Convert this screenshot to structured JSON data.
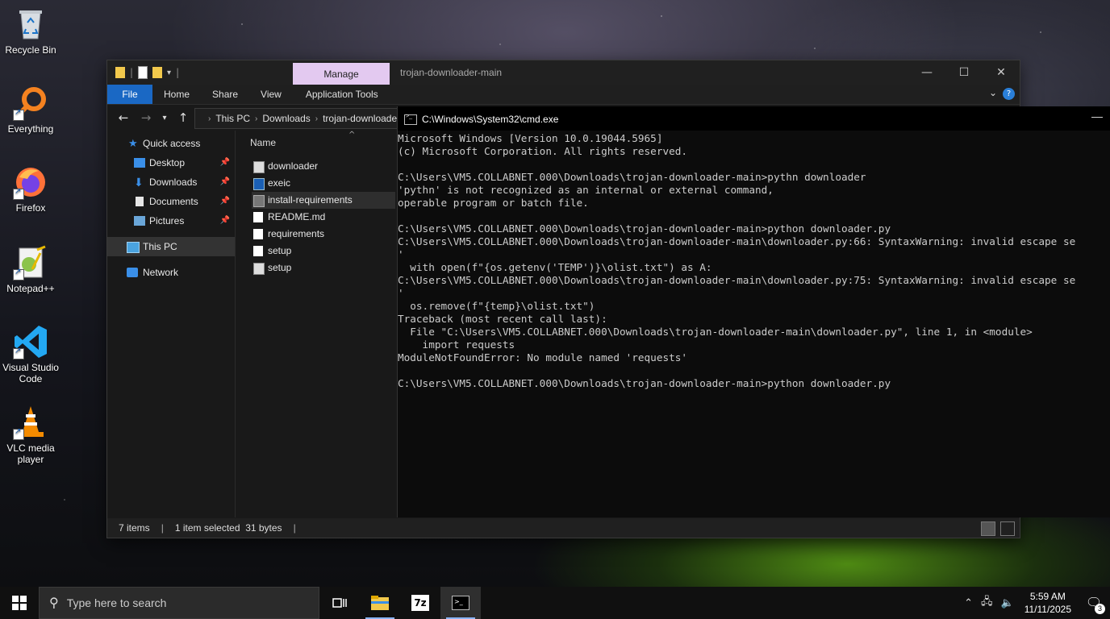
{
  "desktop": {
    "icons": [
      {
        "label": "Recycle Bin",
        "icon": "recycle-bin-icon"
      },
      {
        "label": "Everything",
        "icon": "everything-icon"
      },
      {
        "label": "Firefox",
        "icon": "firefox-icon"
      },
      {
        "label": "Notepad++",
        "icon": "notepad-plus-plus-icon"
      },
      {
        "label": "Visual Studio Code",
        "icon": "vscode-icon"
      },
      {
        "label": "VLC media player",
        "icon": "vlc-icon"
      }
    ]
  },
  "explorer": {
    "contextual_tab": "Manage",
    "title": "trojan-downloader-main",
    "ribbon_tabs": [
      "File",
      "Home",
      "Share",
      "View",
      "Application Tools"
    ],
    "breadcrumb": [
      "This PC",
      "Downloads",
      "trojan-downloader-main"
    ],
    "nav": {
      "quick_access": "Quick access",
      "pinned": [
        "Desktop",
        "Downloads",
        "Documents",
        "Pictures"
      ],
      "this_pc": "This PC",
      "network": "Network"
    },
    "column_header": "Name",
    "files": [
      {
        "name": "downloader",
        "type": "python"
      },
      {
        "name": "exeic",
        "type": "exe"
      },
      {
        "name": "install-requirements",
        "type": "batch",
        "selected": true
      },
      {
        "name": "README.md",
        "type": "text"
      },
      {
        "name": "requirements",
        "type": "text"
      },
      {
        "name": "setup",
        "type": "text"
      },
      {
        "name": "setup",
        "type": "python"
      }
    ],
    "status": {
      "items": "7 items",
      "selection": "1 item selected  31 bytes"
    }
  },
  "cmd": {
    "title": "C:\\Windows\\System32\\cmd.exe",
    "output": "Microsoft Windows [Version 10.0.19044.5965]\n(c) Microsoft Corporation. All rights reserved.\n\nC:\\Users\\VM5.COLLABNET.000\\Downloads\\trojan-downloader-main>pythn downloader\n'pythn' is not recognized as an internal or external command,\noperable program or batch file.\n\nC:\\Users\\VM5.COLLABNET.000\\Downloads\\trojan-downloader-main>python downloader.py\nC:\\Users\\VM5.COLLABNET.000\\Downloads\\trojan-downloader-main\\downloader.py:66: SyntaxWarning: invalid escape se\n'\n  with open(f\"{os.getenv('TEMP')}\\olist.txt\") as A:\nC:\\Users\\VM5.COLLABNET.000\\Downloads\\trojan-downloader-main\\downloader.py:75: SyntaxWarning: invalid escape se\n'\n  os.remove(f\"{temp}\\olist.txt\")\nTraceback (most recent call last):\n  File \"C:\\Users\\VM5.COLLABNET.000\\Downloads\\trojan-downloader-main\\downloader.py\", line 1, in <module>\n    import requests\nModuleNotFoundError: No module named 'requests'\n\nC:\\Users\\VM5.COLLABNET.000\\Downloads\\trojan-downloader-main>python downloader.py"
  },
  "taskbar": {
    "search_placeholder": "Type here to search",
    "time": "5:59 AM",
    "date": "11/11/2025",
    "notification_count": "3",
    "apps": [
      "task-view-icon",
      "file-explorer-icon",
      "7zip-icon",
      "cmd-icon"
    ]
  }
}
